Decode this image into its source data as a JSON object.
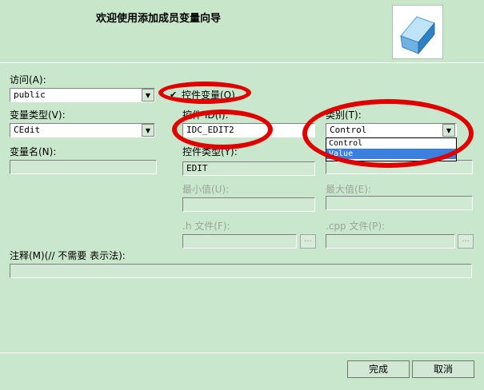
{
  "header": {
    "title": "欢迎使用添加成员变量向导"
  },
  "access": {
    "label": "访问(A):",
    "value": "public"
  },
  "control_var": {
    "label": "控件变量(O)",
    "checked": true
  },
  "var_type": {
    "label": "变量类型(V):",
    "value": "CEdit"
  },
  "control_id": {
    "label": "控件 ID(I):",
    "value": "IDC_EDIT2"
  },
  "category": {
    "label": "类别(T):",
    "value": "Control",
    "options": [
      "Control",
      "Value"
    ],
    "highlighted": "Value"
  },
  "var_name": {
    "label": "变量名(N):",
    "value": ""
  },
  "control_type": {
    "label": "控件类型(Y):",
    "value": "EDIT"
  },
  "max_chars": {
    "value": ""
  },
  "min_value": {
    "label": "最小值(U):",
    "value": ""
  },
  "max_value": {
    "label": "最大值(E):",
    "value": ""
  },
  "h_file": {
    "label": ".h 文件(F):",
    "value": "",
    "browse": "..."
  },
  "cpp_file": {
    "label": ".cpp 文件(P):",
    "value": "",
    "browse": "..."
  },
  "comment": {
    "label": "注释(M)(// 不需要 表示法):",
    "value": ""
  },
  "buttons": {
    "finish": "完成",
    "cancel": "取消"
  },
  "annotation_color": "#e00000"
}
